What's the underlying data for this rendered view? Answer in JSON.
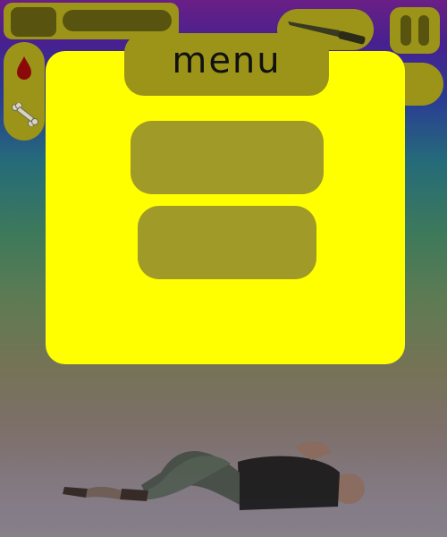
{
  "menu": {
    "title": "menu",
    "button_1_label": "",
    "button_2_label": ""
  },
  "hud": {
    "top_left_panel": "health-bar-panel",
    "left_panel_icons": [
      "blood-drop-icon",
      "bone-icon"
    ],
    "weapon_icon": "knife-icon",
    "pause_icon": "pause-icon"
  },
  "colors": {
    "panel_yellow": "#ffff00",
    "hud_olive": "#9b9419",
    "hud_dark": "#58530f",
    "menu_button": "#a09a28",
    "blood_red": "#8a0a0a"
  }
}
